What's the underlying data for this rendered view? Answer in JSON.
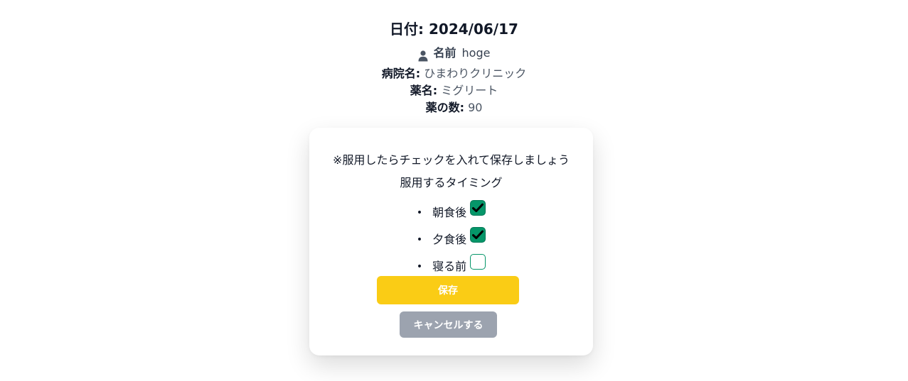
{
  "header": {
    "date_label": "日付: 2024/06/17",
    "user": {
      "icon": "user-icon",
      "label": "名前",
      "value": "hoge"
    },
    "info": [
      {
        "key": "病院名:",
        "value": "ひまわりクリニック"
      },
      {
        "key": "薬名:",
        "value": "ミグリート"
      },
      {
        "key": "薬の数:",
        "value": "90"
      }
    ]
  },
  "card": {
    "note": "※服用したらチェックを入れて保存しましょう",
    "timing_title": "服用するタイミング",
    "timings": [
      {
        "label": "朝食後",
        "checked": true
      },
      {
        "label": "夕食後",
        "checked": true
      },
      {
        "label": "寝る前",
        "checked": false
      }
    ],
    "save_label": "保存",
    "cancel_label": "キャンセルする"
  },
  "colors": {
    "accent_green": "#059669",
    "save_yellow": "#facc15",
    "cancel_gray": "#9ca3af"
  }
}
